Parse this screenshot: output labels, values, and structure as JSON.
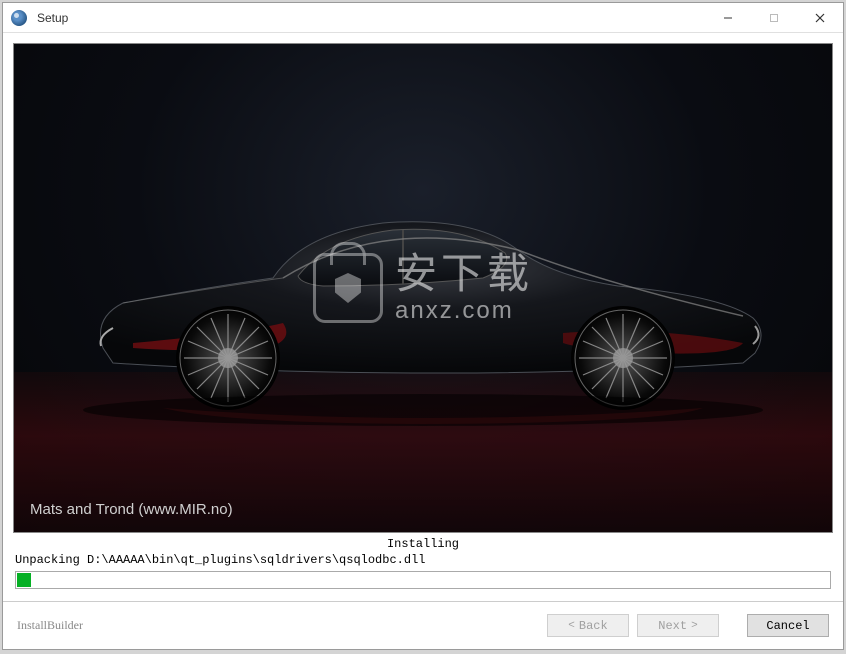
{
  "window": {
    "title": "Setup"
  },
  "hero": {
    "credit": "Mats and Trond (www.MIR.no)",
    "watermark_cn": "安下载",
    "watermark_en": "anxz.com"
  },
  "status": {
    "heading": "Installing",
    "file_line": "Unpacking D:\\AAAAA\\bin\\qt_plugins\\sqldrivers\\qsqlodbc.dll",
    "progress_percent": 2
  },
  "footer": {
    "brand": "InstallBuilder",
    "back_label": "Back",
    "next_label": "Next",
    "cancel_label": "Cancel"
  },
  "colors": {
    "progress_fill": "#06b025",
    "window_bg": "#ffffff"
  }
}
